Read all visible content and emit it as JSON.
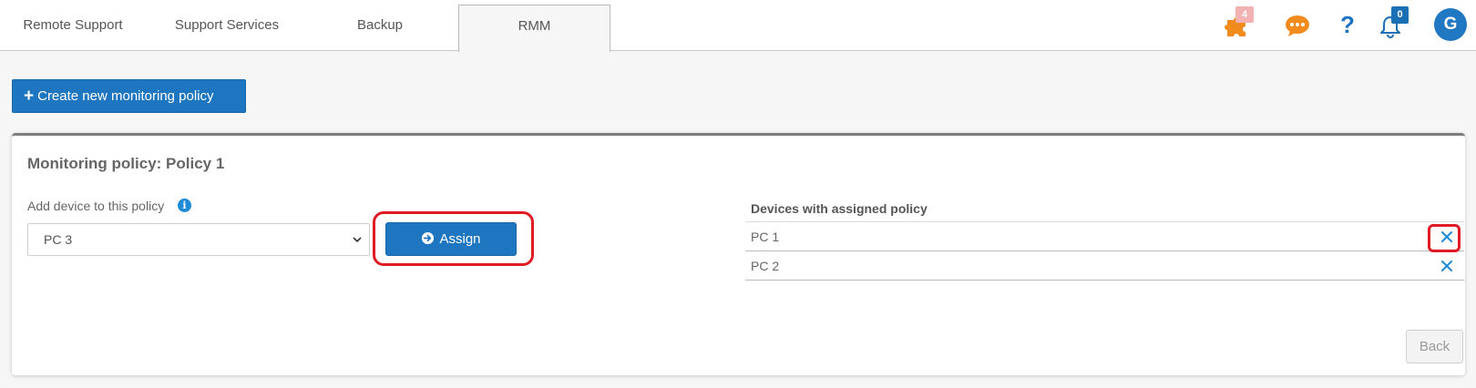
{
  "tabs": [
    {
      "label": "Remote Support"
    },
    {
      "label": "Support Services"
    },
    {
      "label": "Backup"
    },
    {
      "label": "RMM",
      "active": true
    }
  ],
  "header_icons": {
    "puzzle": {
      "icon": "puzzle-icon",
      "badge": "4",
      "color": "#f28b1e"
    },
    "chat": {
      "icon": "chat-icon",
      "color": "#f28b1e"
    },
    "help": {
      "icon": "help-icon",
      "glyph": "?",
      "color": "#1a73c2"
    },
    "bell": {
      "icon": "bell-icon",
      "badge": "0",
      "color": "#1a6fb5"
    },
    "avatar": {
      "initial": "G",
      "color": "#1f78c1"
    }
  },
  "toolbar": {
    "create_label": "Create new monitoring policy",
    "create_icon": "plus-icon"
  },
  "policy": {
    "title": "Monitoring policy: Policy 1",
    "add_label": "Add device to this policy",
    "info_icon": "info-icon",
    "info_glyph": "i",
    "selected_device": "PC 3",
    "assign_label": "Assign",
    "assign_icon": "circle-arrow-right-icon",
    "devices_title": "Devices with assigned policy",
    "devices": [
      {
        "name": "PC 1"
      },
      {
        "name": "PC 2"
      }
    ],
    "back_label": "Back"
  },
  "colors": {
    "primary": "#1f76c0",
    "highlight": "#e01b24"
  }
}
